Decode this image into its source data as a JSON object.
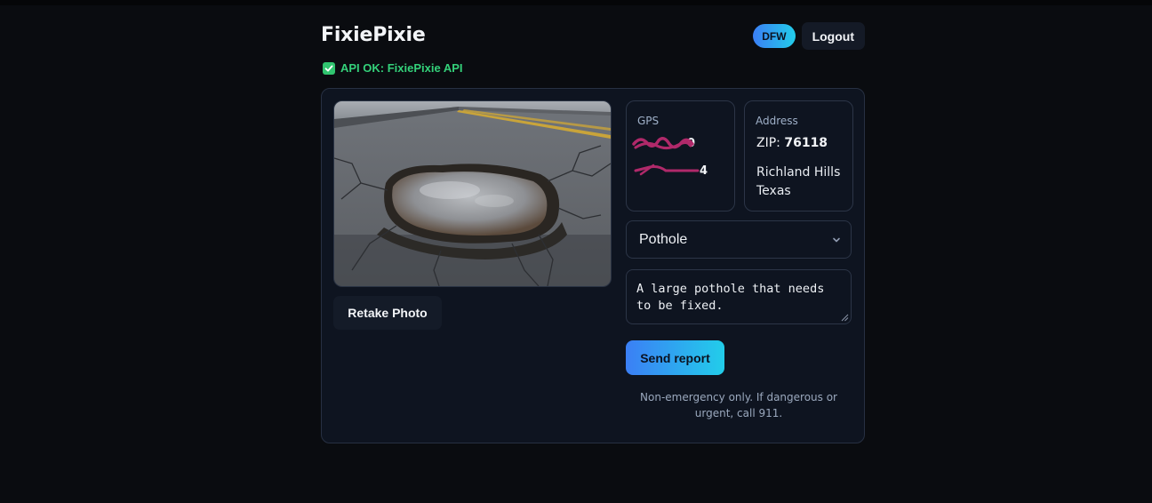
{
  "header": {
    "brand": "FixiePixie",
    "region_badge": "DFW",
    "logout_label": "Logout"
  },
  "status": {
    "icon": "check-icon",
    "text": "API OK: FixiePixie API",
    "color": "#34d17a"
  },
  "photo": {
    "subject": "road pothole filled with water",
    "retake_label": "Retake Photo"
  },
  "gps": {
    "label": "GPS",
    "lat_visible": "0",
    "lon_visible": "4"
  },
  "address": {
    "label": "Address",
    "zip_prefix": "ZIP:",
    "zip": "76118",
    "city": "Richland Hills",
    "state": "Texas"
  },
  "form": {
    "category_selected": "Pothole",
    "description": "A large pothole that needs to be fixed.",
    "send_label": "Send report",
    "disclaimer": "Non-emergency only. If dangerous or urgent, call 911."
  },
  "colors": {
    "accent_start": "#3b7ff5",
    "accent_end": "#22cdea",
    "background": "#0a0c10",
    "card": "#0e1420"
  }
}
